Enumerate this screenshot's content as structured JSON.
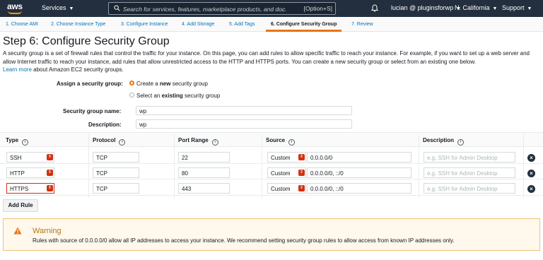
{
  "topnav": {
    "logo": "aws",
    "services": "Services",
    "search_placeholder": "Search for services, features, marketplace products, and docs",
    "search_shortcut": "[Option+S]",
    "user": "lucian @ pluginsforwp",
    "region": "N. California",
    "support": "Support",
    "icons": [
      "search-icon",
      "bell-icon",
      "caret-down-icon"
    ],
    "colors": {
      "nav_bg": "#232f3e",
      "brand": "#ff9900"
    }
  },
  "wizard": {
    "tabs": [
      {
        "label": "1. Choose AMI"
      },
      {
        "label": "2. Choose Instance Type"
      },
      {
        "label": "3. Configure Instance"
      },
      {
        "label": "4. Add Storage"
      },
      {
        "label": "5. Add Tags"
      },
      {
        "label": "6. Configure Security Group",
        "active": true
      },
      {
        "label": "7. Review"
      }
    ],
    "accent": "#ec7211"
  },
  "page": {
    "title": "Step 6: Configure Security Group",
    "intro": "A security group is a set of firewall rules that control the traffic for your instance. On this page, you can add rules to allow specific traffic to reach your instance. For example, if you want to set up a web server and allow Internet traffic to reach your instance, add rules that allow unrestricted access to the HTTP and HTTPS ports. You can create a new security group or select from an existing one below.",
    "learn_more": "Learn more",
    "learn_more_suffix": "about Amazon EC2 security groups."
  },
  "form": {
    "assign_label": "Assign a security group:",
    "option_new_pre": "Create a ",
    "option_new_bold": "new",
    "option_new_post": " security group",
    "option_existing_pre": "Select an ",
    "option_existing_bold": "existing",
    "option_existing_post": " security group",
    "selected": "new",
    "name_label": "Security group name:",
    "name_value": "wp",
    "desc_label": "Description:",
    "desc_value": "wp"
  },
  "table": {
    "headers": {
      "type": "Type",
      "protocol": "Protocol",
      "port": "Port Range",
      "source": "Source",
      "description": "Description",
      "info_icon": "i"
    },
    "rows": [
      {
        "type": "SSH",
        "protocol": "TCP",
        "port": "22",
        "source_mode": "Custom",
        "source": "0.0.0.0/0",
        "desc_placeholder": "e.g. SSH for Admin Desktop"
      },
      {
        "type": "HTTP",
        "protocol": "TCP",
        "port": "80",
        "source_mode": "Custom",
        "source": "0.0.0.0/0, ::/0",
        "desc_placeholder": "e.g. SSH for Admin Desktop"
      },
      {
        "type": "HTTPS",
        "protocol": "TCP",
        "port": "443",
        "source_mode": "Custom",
        "source": "0.0.0.0/0, ::/0",
        "desc_placeholder": "e.g. SSH for Admin Desktop"
      }
    ],
    "add_rule": "Add Rule"
  },
  "warning": {
    "title": "Warning",
    "text": "Rules with source of 0.0.0.0/0 allow all IP addresses to access your instance. We recommend setting security group rules to allow access from known IP addresses only.",
    "icon": "warning-triangle-icon",
    "color": "#b7740e"
  }
}
